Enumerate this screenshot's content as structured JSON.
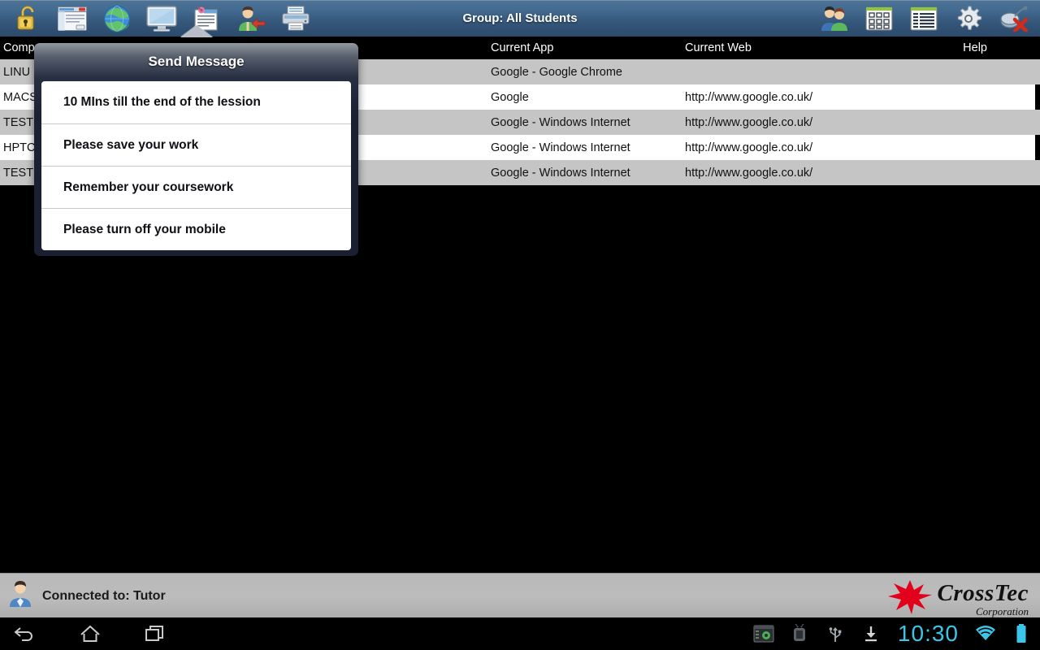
{
  "toolbar": {
    "title": "Group: All Students",
    "left_buttons": [
      {
        "name": "unlock-icon",
        "label": "Unlock"
      },
      {
        "name": "blank-screen-icon",
        "label": "Blank Screen"
      },
      {
        "name": "web-restrict-icon",
        "label": "Web"
      },
      {
        "name": "show-screen-icon",
        "label": "Show"
      },
      {
        "name": "send-message-icon",
        "label": "Message"
      },
      {
        "name": "request-help-icon",
        "label": "Help Request"
      },
      {
        "name": "print-icon",
        "label": "Print"
      }
    ],
    "right_buttons": [
      {
        "name": "students-icon",
        "label": "Students"
      },
      {
        "name": "keypad-icon",
        "label": "Keypad"
      },
      {
        "name": "list-view-icon",
        "label": "List"
      },
      {
        "name": "settings-gear-icon",
        "label": "Settings"
      },
      {
        "name": "disconnect-icon",
        "label": "Disconnect"
      }
    ]
  },
  "table": {
    "columns": [
      "Comp",
      "",
      "",
      "Current App",
      "Current Web",
      "Help"
    ],
    "rows": [
      {
        "name": "LINU",
        "col1": "",
        "col2": "",
        "app": "Google - Google Chrome",
        "web": "",
        "help": ""
      },
      {
        "name": "MACS",
        "col1": "",
        "col2": "",
        "app": "Google",
        "web": "http://www.google.co.uk/",
        "help": ""
      },
      {
        "name": "TEST",
        "col1": "",
        "col2": "",
        "app": "Google - Windows Internet",
        "web": "http://www.google.co.uk/",
        "help": ""
      },
      {
        "name": "HPTC",
        "col1": "",
        "col2": "",
        "app": "Google - Windows Internet",
        "web": "http://www.google.co.uk/",
        "help": ""
      },
      {
        "name": "TEST",
        "col1": "",
        "col2": "",
        "app": "Google - Windows Internet",
        "web": "http://www.google.co.uk/",
        "help": ""
      }
    ]
  },
  "popup": {
    "title": "Send Message",
    "items": [
      "10 MIns till the end of the lession",
      "Please save your work",
      "Remember your coursework",
      "Please turn off your mobile"
    ]
  },
  "status": {
    "connected_text": "Connected to: Tutor",
    "brand_name": "CrossTec",
    "brand_sub": "Corporation"
  },
  "navbar": {
    "back_icon": "back-arrow-icon",
    "home_icon": "home-icon",
    "recents_icon": "recent-apps-icon",
    "clock": "10:30",
    "tray_icons": [
      "screenshot-icon",
      "android-usb-icon",
      "usb-icon",
      "download-icon",
      "wifi-icon",
      "battery-icon"
    ]
  },
  "colors": {
    "toolbar_top": "#4e7396",
    "toolbar_bottom": "#2b4a6b",
    "popup_bg": "#1a2031",
    "row_odd": "#c5c5c5",
    "row_even": "#ffffff",
    "header_bg": "#000000",
    "clock": "#3bc6e8",
    "brand_star": "#e3001b"
  }
}
